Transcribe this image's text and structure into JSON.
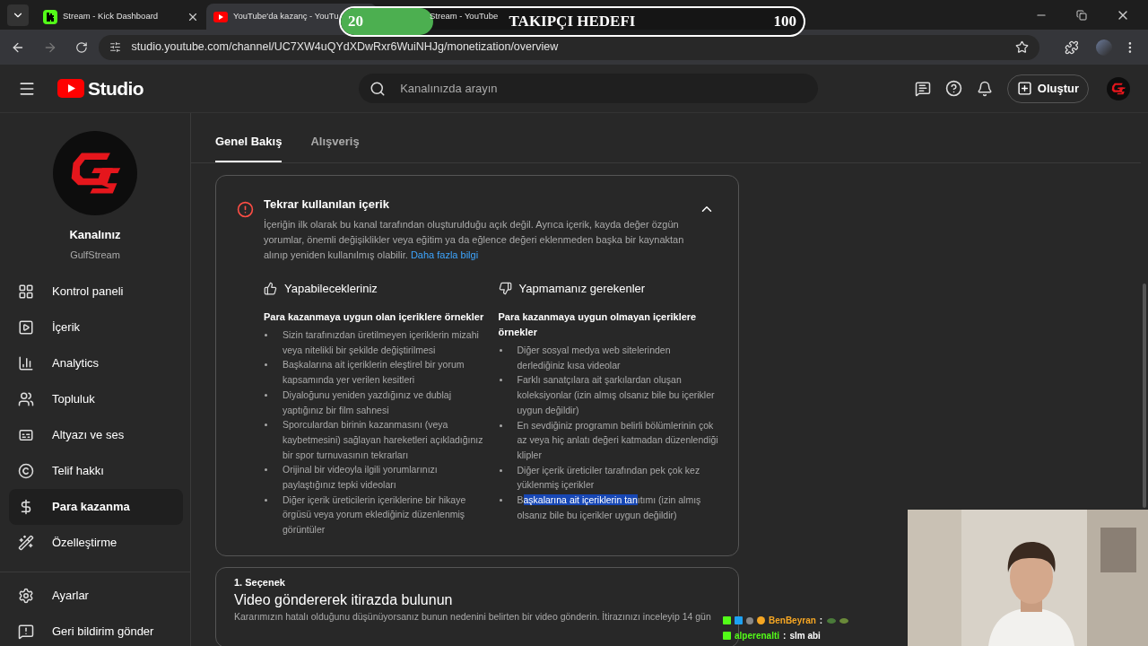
{
  "browser": {
    "tabs": [
      {
        "kind": "kick",
        "title": "Stream - Kick Dashboard",
        "selected": false
      },
      {
        "kind": "youtube",
        "title": "YouTube'da kazanç - YouTu",
        "selected": true
      },
      {
        "title": "Stream - YouTube",
        "selected": false
      }
    ],
    "url": "studio.youtube.com/channel/UC7XW4uQYdXDwRxr6WuiNHJg/monetization/overview"
  },
  "goal_overlay": {
    "current": "20",
    "title": "TAKIPÇI HEDEFI",
    "target": "100",
    "level": 0.2
  },
  "header": {
    "logo_text": "Studio",
    "search_placeholder": "Kanalınızda arayın",
    "create_button": "Oluştur"
  },
  "sidebar": {
    "channel_label": "Kanalınız",
    "channel_name": "GulfStream",
    "items": [
      {
        "label": "Kontrol paneli",
        "selected": false
      },
      {
        "label": "İçerik",
        "selected": false
      },
      {
        "label": "Analytics",
        "selected": false
      },
      {
        "label": "Topluluk",
        "selected": false
      },
      {
        "label": "Altyazı ve ses",
        "selected": false
      },
      {
        "label": "Telif hakkı",
        "selected": false
      },
      {
        "label": "Para kazanma",
        "selected": true
      },
      {
        "label": "Özelleştirme",
        "selected": false
      }
    ],
    "footer_items": [
      {
        "label": "Ayarlar"
      },
      {
        "label": "Geri bildirim gönder"
      }
    ]
  },
  "page_tabs": [
    {
      "label": "Genel Bakış",
      "selected": true
    },
    {
      "label": "Alışveriş",
      "selected": false
    }
  ],
  "notice": {
    "title": "Tekrar kullanılan içerik",
    "body": "İçeriğin ilk olarak bu kanal tarafından oluşturulduğu açık değil. Ayrıca içerik, kayda değer özgün yorumlar, önemli değişiklikler veya eğitim ya da eğlence değeri eklenmeden başka bir kaynaktan alınıp yeniden kullanılmış olabilir.",
    "link": "Daha fazla bilgi",
    "expanded": true,
    "columns": [
      {
        "kind": "do",
        "heading": "Yapabilecekleriniz",
        "subheading": "Para kazanmaya uygun olan içeriklere örnekler",
        "items": [
          {
            "text": "Sizin tarafınızdan üretilmeyen içeriklerin mizahi veya nitelikli bir şekilde değiştirilmesi"
          },
          {
            "text": "Başkalarına ait içeriklerin eleştirel bir yorum kapsamında yer verilen kesitleri"
          },
          {
            "text": "Diyaloğunu yeniden yazdığınız ve dublaj yaptığınız bir film sahnesi"
          },
          {
            "text": "Sporculardan birinin kazanmasını (veya kaybetmesini) sağlayan hareketleri açıkladığınız bir spor turnuvasının tekrarları"
          },
          {
            "text": "Orijinal bir videoyla ilgili yorumlarınızı paylaştığınız tepki videoları"
          },
          {
            "text": "Diğer içerik üreticilerin içeriklerine bir hikaye örgüsü veya yorum eklediğiniz düzenlenmiş görüntüler"
          }
        ]
      },
      {
        "kind": "dont",
        "heading": "Yapmamanız gerekenler",
        "subheading": "Para kazanmaya uygun olmayan içeriklere örnekler",
        "items": [
          {
            "text": "Diğer sosyal medya web sitelerinden derlediğiniz kısa videolar"
          },
          {
            "text": "Farklı sanatçılara ait şarkılardan oluşan koleksiyonlar (izin almış olsanız bile bu içerikler uygun değildir)"
          },
          {
            "text": "En sevdiğiniz programın belirli bölümlerinin çok az veya hiç anlatı değeri katmadan düzenlendiği klipler"
          },
          {
            "text": "Diğer içerik üreticiler tarafından pek çok kez yüklenmiş içerikler"
          },
          {
            "text": "B",
            "selected_text": "aşkalarına ait içeriklerin tan",
            "after": "ıtımı (izin almış olsanız bile bu içerikler uygun değildir)"
          }
        ]
      }
    ]
  },
  "option_card": {
    "label": "1. Seçenek",
    "title": "Video göndererek itirazda bulunun",
    "body": "Kararımızın hatalı olduğunu düşünüyorsanız bunun nedenini belirten bir video gönderin. İtirazınızı inceleyip 14 gün"
  },
  "chat": [
    {
      "user": "BenBeyran",
      "color": "#f5a623",
      "separator": ":",
      "emotes": true
    },
    {
      "user": "alperenalti",
      "color": "#53fc18",
      "separator": ":",
      "message": "slm abi",
      "emotes": false
    }
  ]
}
